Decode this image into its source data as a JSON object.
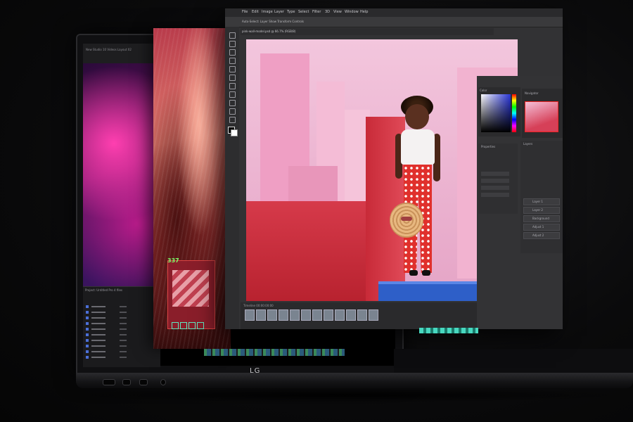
{
  "brand": {
    "logo_text": "LG"
  },
  "premiere": {
    "header_text": "New Studio 10 Videos Layout 02",
    "project_panel_title": "Project: Untitled Pro 4 files",
    "rows": 10
  },
  "overlay_card": {
    "number": "337"
  },
  "photoshop": {
    "menu": [
      "File",
      "Edit",
      "Image",
      "Layer",
      "Type",
      "Select",
      "Filter",
      "3D",
      "View",
      "Window",
      "Help"
    ],
    "options_bar": "Auto-Select:  Layer   Show Transform Controls",
    "doc_tab": "pink-wall-model.psd @ 66.7% (RGB/8)",
    "timeline_header": "Timeline  00:00:00:00",
    "panels": {
      "color": "Color",
      "navigator": "Navigator",
      "layers": "Layers",
      "properties": "Properties"
    },
    "layer_names": [
      "Layer 1",
      "Layer 2",
      "Background",
      "Adjust 1",
      "Adjust 2"
    ]
  },
  "colors": {
    "accent_red": "#d63a4a",
    "pedestal_blue": "#2e5fc8",
    "pink_bg": "#f3c6dd",
    "green_text": "#7dff6a"
  }
}
